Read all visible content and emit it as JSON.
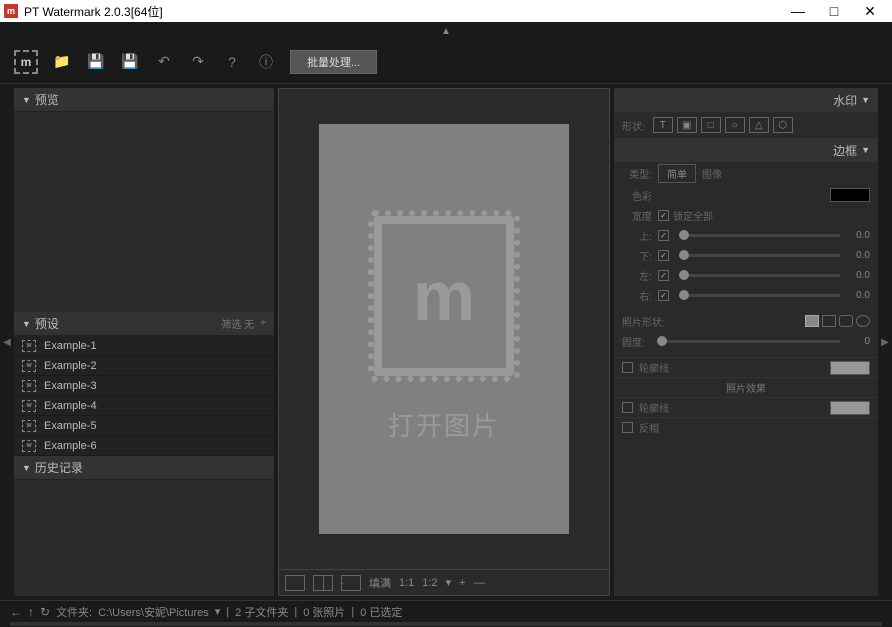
{
  "title": "PT Watermark 2.0.3[64位]",
  "toolbar": {
    "batch": "批量处理..."
  },
  "left": {
    "preview": "预览",
    "presets": "预设",
    "presets_right": "筛选  无",
    "history": "历史记录",
    "items": [
      "Example-1",
      "Example-2",
      "Example-3",
      "Example-4",
      "Example-5",
      "Example-6"
    ]
  },
  "center": {
    "open": "打开图片",
    "fill": "填满",
    "z1": "1:1",
    "z2": "1:2"
  },
  "right": {
    "watermark": "水印",
    "border": "边框",
    "shape_label": "形状:",
    "type": "类型:",
    "type_simple": "简单",
    "type_image": "图像",
    "color": "色彩",
    "width": "宽度",
    "lock": "锁定全部",
    "top": "上:",
    "bottom": "下:",
    "left": "左:",
    "right_lbl": "右:",
    "val": "0.0",
    "corner": "照片形状:",
    "roundness": "圆度:",
    "outline": "轮廓线",
    "effects": "照片效果",
    "blur_line": "轮廓线",
    "invert": "反相"
  },
  "status": {
    "folder": "文件夹:",
    "path": "C:\\Users\\安妮\\Pictures",
    "sub": "2 子文件夹",
    "photos": "0 张照片",
    "selected": "0 已选定"
  }
}
